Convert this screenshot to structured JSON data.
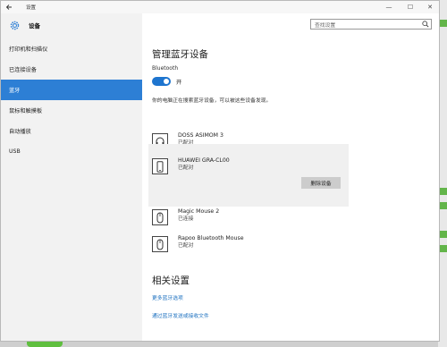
{
  "window": {
    "title": "设置",
    "back_icon": "back-arrow-icon",
    "minimize": "—",
    "maximize": "☐",
    "close": "✕"
  },
  "sidebar": {
    "header_label": "设备",
    "items": [
      {
        "label": "打印机和扫描仪"
      },
      {
        "label": "已连接设备"
      },
      {
        "label": "蓝牙"
      },
      {
        "label": "鼠标和触摸板"
      },
      {
        "label": "自动播放"
      },
      {
        "label": "USB"
      }
    ],
    "active_index": 2
  },
  "search": {
    "placeholder": "查找设置"
  },
  "main": {
    "title": "管理蓝牙设备",
    "bluetooth_label": "Bluetooth",
    "toggle_state": "开",
    "status": "你的电脑正在搜索蓝牙设备，可以被这些设备发现。",
    "devices": [
      {
        "name": "DOSS ASIMOM 3",
        "state": "已配对",
        "icon": "headphones-icon"
      },
      {
        "name": "HUAWEI GRA-CL00",
        "state": "已配对",
        "icon": "phone-icon"
      },
      {
        "name": "Magic Mouse 2",
        "state": "已连接",
        "icon": "mouse-icon"
      },
      {
        "name": "Rapoo Bluetooth Mouse",
        "state": "已配对",
        "icon": "mouse-icon"
      }
    ],
    "remove_button": "删除设备",
    "related_title": "相关设置",
    "links": [
      {
        "label": "更多蓝牙选项"
      },
      {
        "label": "通过蓝牙发送或接收文件"
      }
    ]
  },
  "colors": {
    "accent": "#2d7fd5",
    "toggle_on": "#1e75cf",
    "link": "#1a6fbf"
  }
}
